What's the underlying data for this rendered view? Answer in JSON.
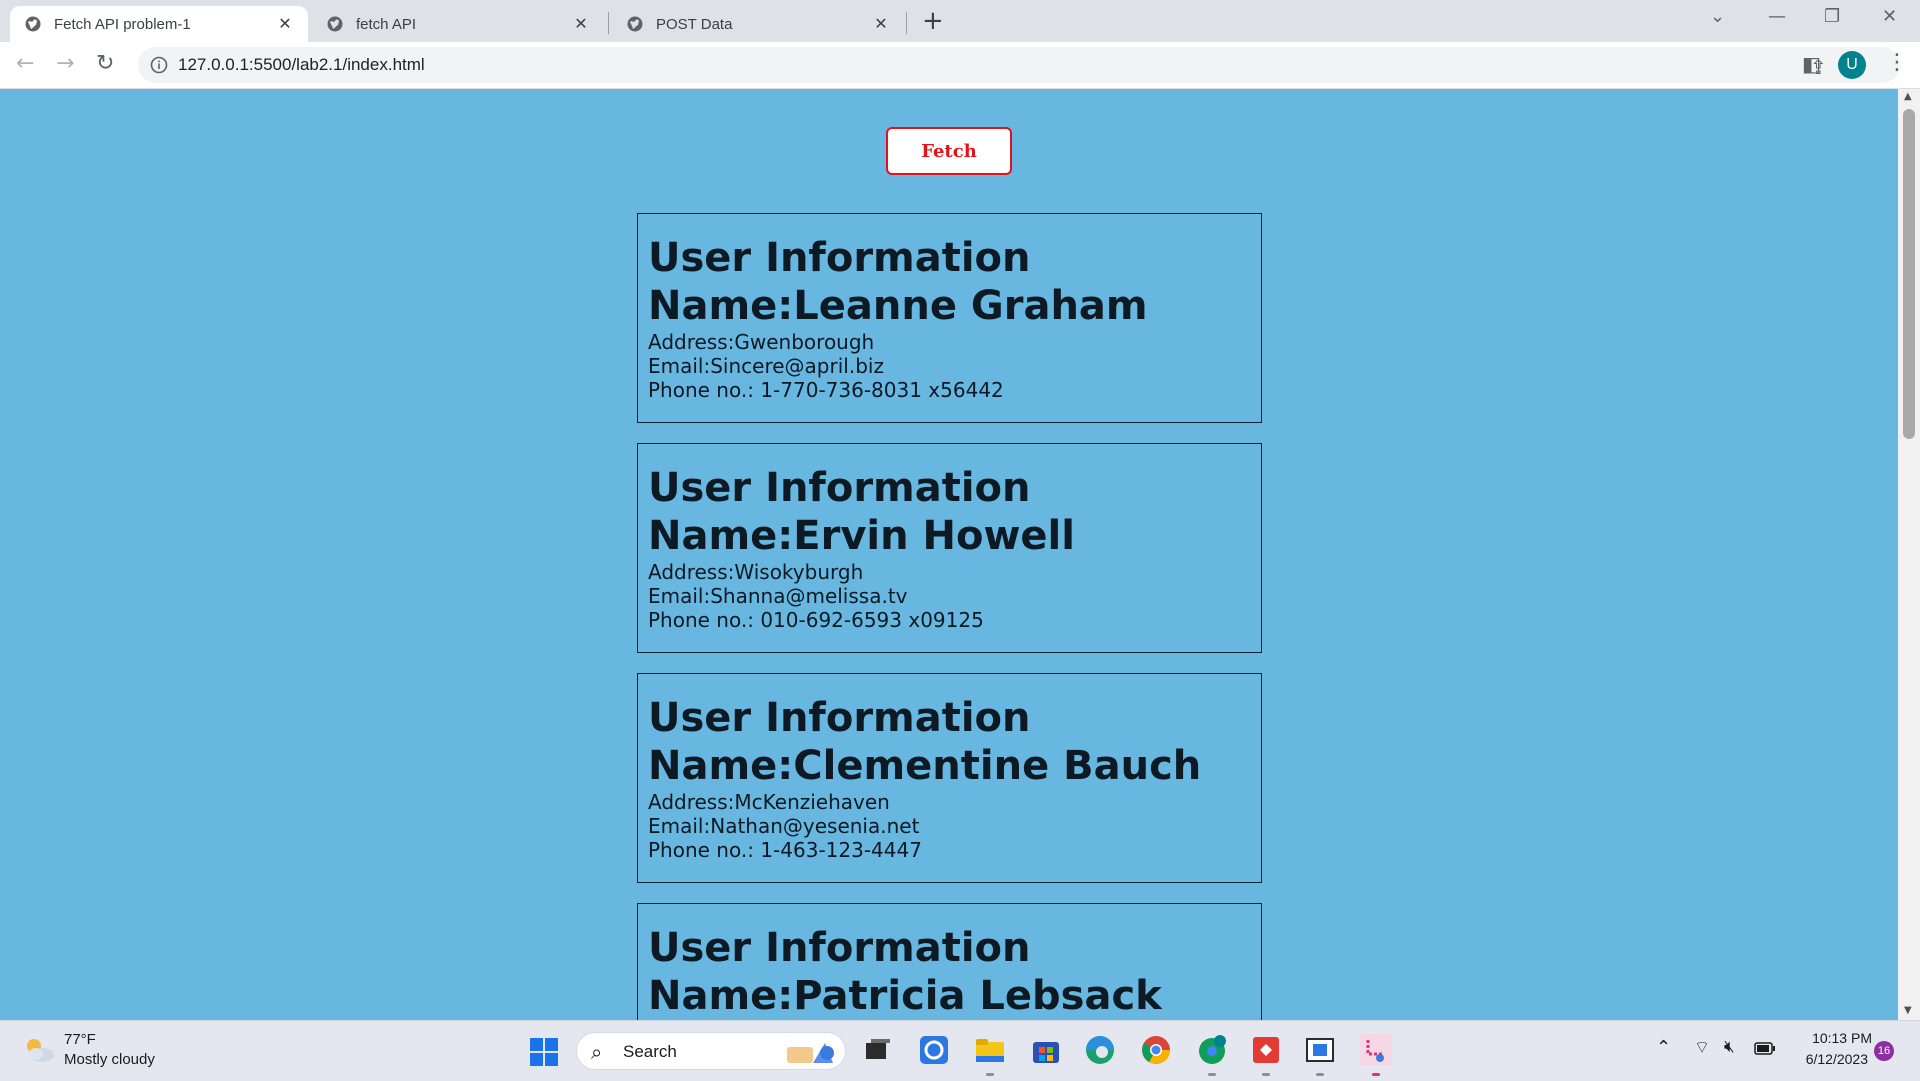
{
  "browser": {
    "tabs": [
      {
        "title": "Fetch API problem-1",
        "active": true
      },
      {
        "title": "fetch API",
        "active": false
      },
      {
        "title": "POST Data",
        "active": false
      }
    ],
    "url": "127.0.0.1:5500/lab2.1/index.html",
    "profile_initial": "U",
    "icons": [
      "back-arrow-icon",
      "forward-arrow-icon",
      "reload-icon",
      "info-icon",
      "share-icon",
      "bookmark-star-icon",
      "side-panel-icon",
      "kebab-menu-icon"
    ]
  },
  "page": {
    "background": "#68b7e1",
    "fetch_label": "Fetch",
    "fetch_color": "#e3131b",
    "users": [
      {
        "heading": "User Information",
        "name": "Name:Leanne Graham",
        "address": "Address:Gwenborough",
        "email": "Email:Sincere@april.biz",
        "phone": "Phone no.: 1-770-736-8031 x56442"
      },
      {
        "heading": "User Information",
        "name": "Name:Ervin Howell",
        "address": "Address:Wisokyburgh",
        "email": "Email:Shanna@melissa.tv",
        "phone": "Phone no.: 010-692-6593 x09125"
      },
      {
        "heading": "User Information",
        "name": "Name:Clementine Bauch",
        "address": "Address:McKenziehaven",
        "email": "Email:Nathan@yesenia.net",
        "phone": "Phone no.: 1-463-123-4447"
      },
      {
        "heading": "User Information",
        "name": "Name:Patricia Lebsack"
      }
    ]
  },
  "taskbar": {
    "weather": {
      "temp": "77°F",
      "condition": "Mostly cloudy"
    },
    "search_label": "Search",
    "apps": [
      "file-explorer-icon",
      "task-view-icon",
      "store-icon",
      "edge-icon",
      "chrome-icon",
      "chrome-profile-icon",
      "git-icon",
      "app-window-icon",
      "snipping-tool-icon"
    ],
    "time": "10:13 PM",
    "date": "6/12/2023",
    "notification_count": "16"
  }
}
